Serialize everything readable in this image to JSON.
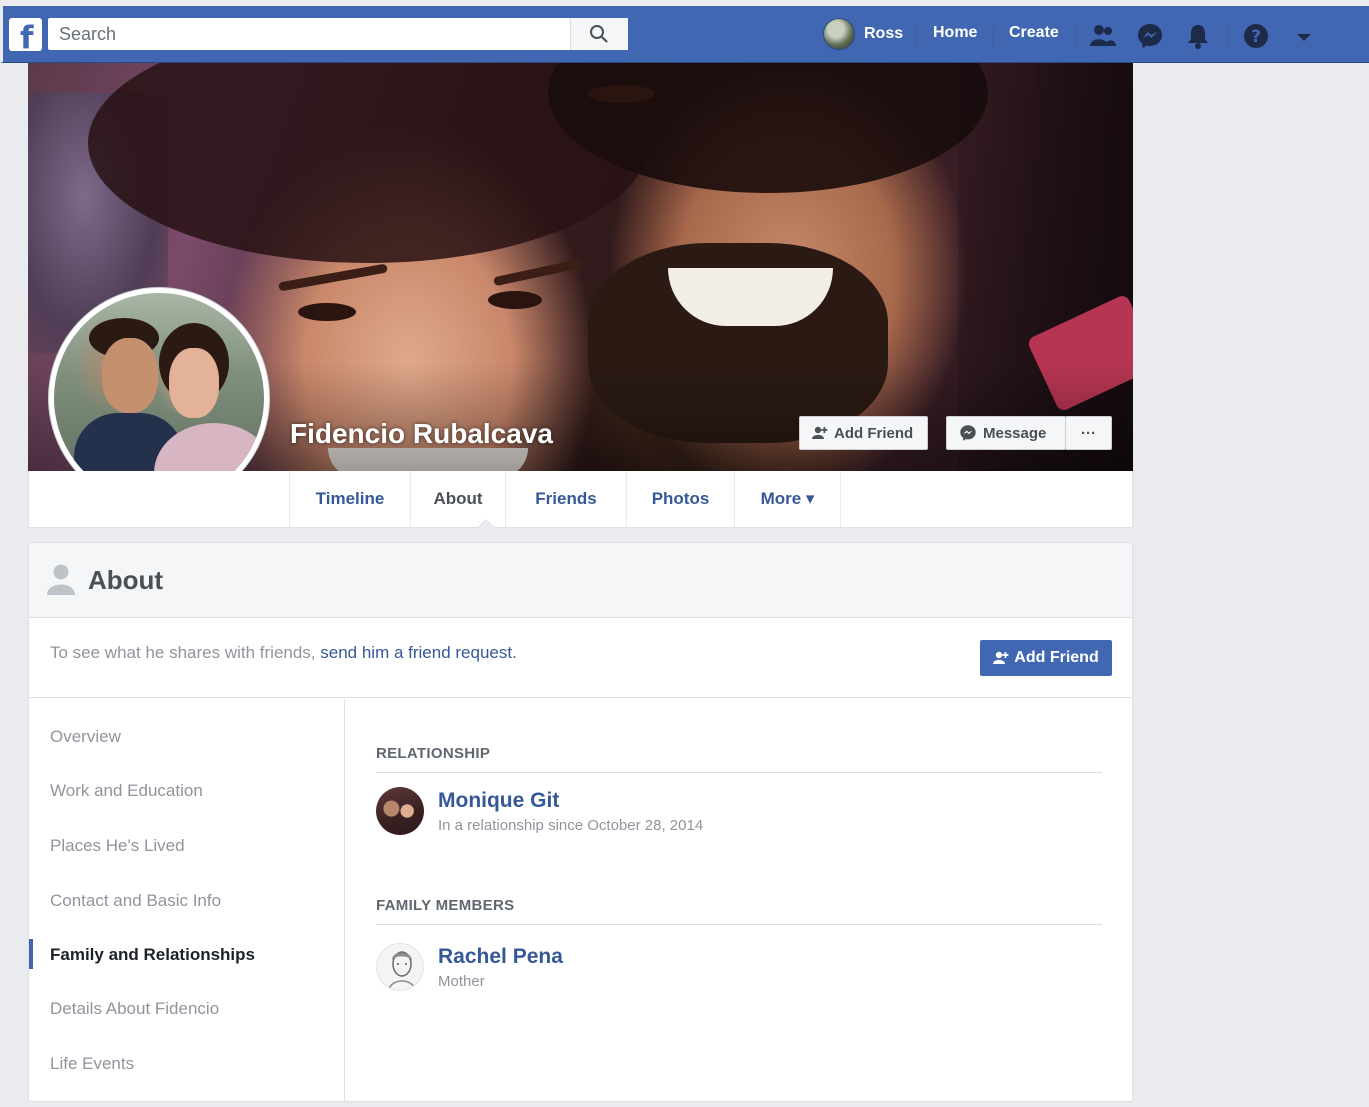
{
  "topbar": {
    "search_placeholder": "Search",
    "user_name": "Ross",
    "home_label": "Home",
    "create_label": "Create",
    "icons": [
      "friends-requests-icon",
      "messenger-icon",
      "notifications-icon",
      "help-icon",
      "account-menu-caret-icon"
    ]
  },
  "cover": {
    "profile_name": "Fidencio Rubalcava",
    "add_friend_label": "Add Friend",
    "message_label": "Message",
    "more_label": "···"
  },
  "tabs": [
    {
      "label": "Timeline"
    },
    {
      "label": "About"
    },
    {
      "label": "Friends"
    },
    {
      "label": "Photos"
    },
    {
      "label": "More ▾"
    }
  ],
  "about": {
    "title": "About",
    "note_text": "To see what he shares with friends, ",
    "note_link": "send him a friend request.",
    "add_friend_label": "Add Friend",
    "side_nav": [
      {
        "label": "Overview"
      },
      {
        "label": "Work and Education"
      },
      {
        "label": "Places He's Lived"
      },
      {
        "label": "Contact and Basic Info"
      },
      {
        "label": "Family and Relationships"
      },
      {
        "label": "Details About Fidencio"
      },
      {
        "label": "Life Events"
      }
    ],
    "relationship_header": "RELATIONSHIP",
    "relationship": {
      "name": "Monique Git",
      "detail": "In a relationship since October 28, 2014"
    },
    "family_header": "FAMILY MEMBERS",
    "family": {
      "name": "Rachel Pena",
      "detail": "Mother"
    }
  },
  "colors": {
    "brand_blue": "#4267b2",
    "link_blue": "#365899",
    "page_bg": "#e9ebee"
  }
}
